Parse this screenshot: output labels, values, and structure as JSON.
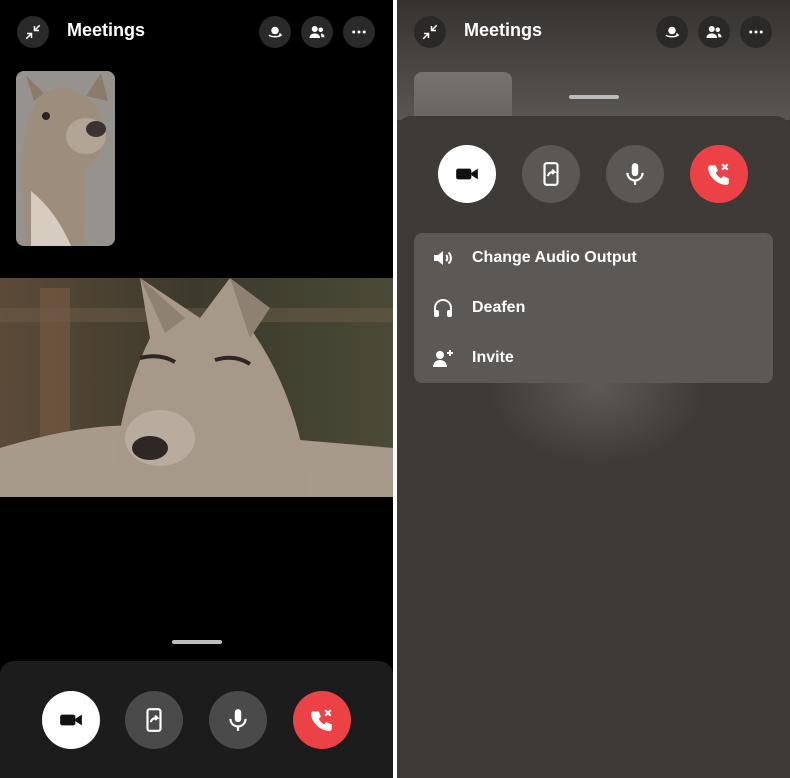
{
  "left": {
    "header": {
      "title": "Meetings"
    }
  },
  "right": {
    "header": {
      "title": "Meetings"
    },
    "menu": {
      "items": [
        {
          "label": "Change Audio Output",
          "icon": "speaker-icon"
        },
        {
          "label": "Deafen",
          "icon": "headphones-icon"
        },
        {
          "label": "Invite",
          "icon": "add-person-icon"
        }
      ]
    }
  },
  "colors": {
    "end_call": "#ed4245",
    "camera_active": "#ffffff",
    "control_inactive": "#4a4a4a"
  },
  "icons": [
    "minimize-icon",
    "camera-flip-icon",
    "participants-icon",
    "more-icon",
    "video-camera-icon",
    "screen-share-icon",
    "microphone-icon",
    "end-call-icon"
  ]
}
